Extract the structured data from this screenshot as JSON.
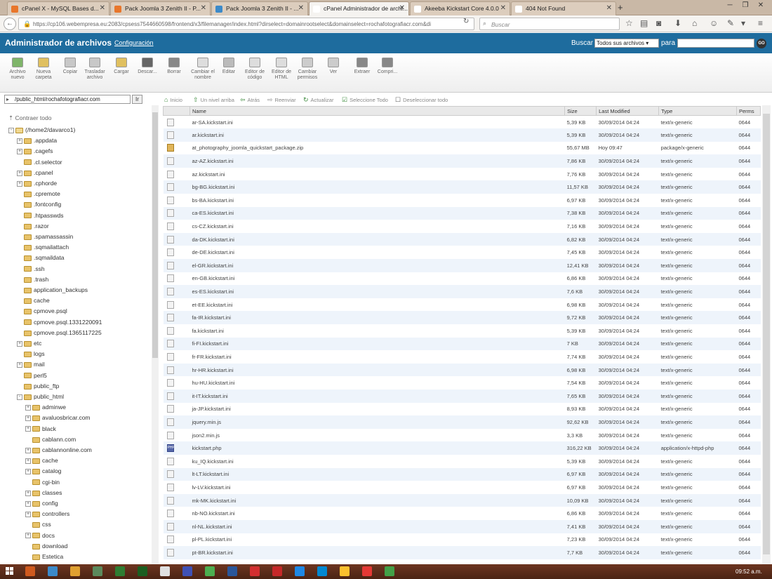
{
  "browser": {
    "tabs": [
      {
        "title": "cPanel X - MySQL Bases d...",
        "color": "#e8762b"
      },
      {
        "title": "Pack Joomla 3 Zenith II - P...",
        "color": "#e8762b"
      },
      {
        "title": "Pack Joomla 3 Zenith II - ...",
        "color": "#3c8ac9"
      },
      {
        "title": "cPanel Administrador de archi...",
        "color": "#ffffff"
      },
      {
        "title": "Akeeba Kickstart Core 4.0.0",
        "color": "#ffffff"
      },
      {
        "title": "404 Not Found",
        "color": "#ffffff"
      }
    ],
    "url": "https://cp106.webempresa.eu:2083/cpsess7544660598/frontend/x3/filemanager/index.html?dirselect=domainrootselect&domainselect=rochafotografiacr.com&di",
    "search_placeholder": "Buscar"
  },
  "cpanel": {
    "title": "Administrador de archivos",
    "config_link": "Configuración",
    "search_label": "Buscar",
    "search_scope": "Todos sus archivos",
    "para_label": "para",
    "go_label": "GO"
  },
  "toolbar": [
    {
      "label": "Archivo nuevo",
      "icon": "new-file-icon",
      "color": "#7fb56a"
    },
    {
      "label": "Nueva carpeta",
      "icon": "new-folder-icon",
      "color": "#e0c060"
    },
    {
      "label": "Copiar",
      "icon": "copy-icon",
      "color": "#c8c8c8"
    },
    {
      "label": "Trasladar archivo",
      "icon": "move-icon",
      "color": "#c8c8c8"
    },
    {
      "label": "Cargar",
      "icon": "upload-icon",
      "color": "#e0c060"
    },
    {
      "label": "Descar...",
      "icon": "download-icon",
      "color": "#666666"
    },
    {
      "label": "Borrar",
      "icon": "delete-icon",
      "color": "#888888"
    },
    {
      "label": "Cambiar el nombre",
      "icon": "rename-icon",
      "color": "#dddddd"
    },
    {
      "label": "Editar",
      "icon": "edit-icon",
      "color": "#bbbbbb"
    },
    {
      "label": "Editor de código",
      "icon": "code-editor-icon",
      "color": "#dddddd"
    },
    {
      "label": "Editor de HTML",
      "icon": "html-editor-icon",
      "color": "#dddddd"
    },
    {
      "label": "Cambiar permisos",
      "icon": "permissions-icon",
      "color": "#cccccc"
    },
    {
      "label": "Ver",
      "icon": "view-icon",
      "color": "#cccccc"
    },
    {
      "label": "Extraer",
      "icon": "extract-icon",
      "color": "#888888"
    },
    {
      "label": "Compri...",
      "icon": "compress-icon",
      "color": "#888888"
    }
  ],
  "pathbar": {
    "path": "/public_html/rochafotografiacr.com",
    "go_label": "Ir",
    "actions": [
      {
        "label": "Inicio",
        "icon": "home-icon"
      },
      {
        "label": "Un nivel arriba",
        "icon": "up-level-icon"
      },
      {
        "label": "Atrás",
        "icon": "back-icon"
      },
      {
        "label": "Reenviar",
        "icon": "forward-icon"
      },
      {
        "label": "Actualizar",
        "icon": "refresh-icon"
      },
      {
        "label": "Seleccione Todo",
        "icon": "select-all-icon"
      },
      {
        "label": "Deseleccionar todo",
        "icon": "deselect-all-icon"
      }
    ]
  },
  "tree": {
    "collapse_all": "Contraer todo",
    "nodes": [
      {
        "label": "(/home2/davarco1)",
        "level": 0,
        "expand": "−",
        "root": true
      },
      {
        "label": ".appdata",
        "level": 1,
        "expand": "+"
      },
      {
        "label": ".cagefs",
        "level": 1,
        "expand": "+"
      },
      {
        "label": ".cl.selector",
        "level": 1,
        "expand": ""
      },
      {
        "label": ".cpanel",
        "level": 1,
        "expand": "+"
      },
      {
        "label": ".cphorde",
        "level": 1,
        "expand": "+"
      },
      {
        "label": ".cpremote",
        "level": 1,
        "expand": ""
      },
      {
        "label": ".fontconfig",
        "level": 1,
        "expand": ""
      },
      {
        "label": ".htpasswds",
        "level": 1,
        "expand": ""
      },
      {
        "label": ".razor",
        "level": 1,
        "expand": ""
      },
      {
        "label": ".spamassassin",
        "level": 1,
        "expand": ""
      },
      {
        "label": ".sqmailattach",
        "level": 1,
        "expand": ""
      },
      {
        "label": ".sqmaildata",
        "level": 1,
        "expand": ""
      },
      {
        "label": ".ssh",
        "level": 1,
        "expand": ""
      },
      {
        "label": ".trash",
        "level": 1,
        "expand": ""
      },
      {
        "label": "application_backups",
        "level": 1,
        "expand": ""
      },
      {
        "label": "cache",
        "level": 1,
        "expand": ""
      },
      {
        "label": "cpmove.psql",
        "level": 1,
        "expand": ""
      },
      {
        "label": "cpmove.psql.1331220091",
        "level": 1,
        "expand": ""
      },
      {
        "label": "cpmove.psql.1365117225",
        "level": 1,
        "expand": ""
      },
      {
        "label": "etc",
        "level": 1,
        "expand": "+"
      },
      {
        "label": "logs",
        "level": 1,
        "expand": ""
      },
      {
        "label": "mail",
        "level": 1,
        "expand": "+"
      },
      {
        "label": "perl5",
        "level": 1,
        "expand": ""
      },
      {
        "label": "public_ftp",
        "level": 1,
        "expand": ""
      },
      {
        "label": "public_html",
        "level": 1,
        "expand": "−"
      },
      {
        "label": "adminwe",
        "level": 2,
        "expand": "+"
      },
      {
        "label": "avaluosbricar.com",
        "level": 2,
        "expand": "+"
      },
      {
        "label": "black",
        "level": 2,
        "expand": "+"
      },
      {
        "label": "cablann.com",
        "level": 2,
        "expand": ""
      },
      {
        "label": "cablannonline.com",
        "level": 2,
        "expand": "+"
      },
      {
        "label": "cache",
        "level": 2,
        "expand": "+"
      },
      {
        "label": "catalog",
        "level": 2,
        "expand": "+"
      },
      {
        "label": "cgi-bin",
        "level": 2,
        "expand": ""
      },
      {
        "label": "classes",
        "level": 2,
        "expand": "+"
      },
      {
        "label": "config",
        "level": 2,
        "expand": "+"
      },
      {
        "label": "controllers",
        "level": 2,
        "expand": "+"
      },
      {
        "label": "css",
        "level": 2,
        "expand": ""
      },
      {
        "label": "docs",
        "level": 2,
        "expand": "+"
      },
      {
        "label": "download",
        "level": 2,
        "expand": ""
      },
      {
        "label": "Estetica",
        "level": 2,
        "expand": ""
      }
    ]
  },
  "table": {
    "headers": [
      "",
      "Name",
      "Size",
      "Last Modified",
      "Type",
      "Perms"
    ],
    "rows": [
      [
        "txt",
        "ar-SA.kickstart.ini",
        "5,39 KB",
        "30/09/2014 04:24",
        "text/x-generic",
        "0644"
      ],
      [
        "txt",
        "ar.kickstart.ini",
        "5,39 KB",
        "30/09/2014 04:24",
        "text/x-generic",
        "0644"
      ],
      [
        "zip",
        "at_photography_joomla_quickstart_package.zip",
        "55,67 MB",
        "Hoy 09:47",
        "package/x-generic",
        "0644"
      ],
      [
        "txt",
        "az-AZ.kickstart.ini",
        "7,86 KB",
        "30/09/2014 04:24",
        "text/x-generic",
        "0644"
      ],
      [
        "txt",
        "az.kickstart.ini",
        "7,76 KB",
        "30/09/2014 04:24",
        "text/x-generic",
        "0644"
      ],
      [
        "txt",
        "bg-BG.kickstart.ini",
        "11,57 KB",
        "30/09/2014 04:24",
        "text/x-generic",
        "0644"
      ],
      [
        "txt",
        "bs-BA.kickstart.ini",
        "6,97 KB",
        "30/09/2014 04:24",
        "text/x-generic",
        "0644"
      ],
      [
        "txt",
        "ca-ES.kickstart.ini",
        "7,38 KB",
        "30/09/2014 04:24",
        "text/x-generic",
        "0644"
      ],
      [
        "txt",
        "cs-CZ.kickstart.ini",
        "7,16 KB",
        "30/09/2014 04:24",
        "text/x-generic",
        "0644"
      ],
      [
        "txt",
        "da-DK.kickstart.ini",
        "6,82 KB",
        "30/09/2014 04:24",
        "text/x-generic",
        "0644"
      ],
      [
        "txt",
        "de-DE.kickstart.ini",
        "7,45 KB",
        "30/09/2014 04:24",
        "text/x-generic",
        "0644"
      ],
      [
        "txt",
        "el-GR.kickstart.ini",
        "12,41 KB",
        "30/09/2014 04:24",
        "text/x-generic",
        "0644"
      ],
      [
        "txt",
        "en-GB.kickstart.ini",
        "6,86 KB",
        "30/09/2014 04:24",
        "text/x-generic",
        "0644"
      ],
      [
        "txt",
        "es-ES.kickstart.ini",
        "7,6 KB",
        "30/09/2014 04:24",
        "text/x-generic",
        "0644"
      ],
      [
        "txt",
        "et-EE.kickstart.ini",
        "6,98 KB",
        "30/09/2014 04:24",
        "text/x-generic",
        "0644"
      ],
      [
        "txt",
        "fa-IR.kickstart.ini",
        "9,72 KB",
        "30/09/2014 04:24",
        "text/x-generic",
        "0644"
      ],
      [
        "txt",
        "fa.kickstart.ini",
        "5,39 KB",
        "30/09/2014 04:24",
        "text/x-generic",
        "0644"
      ],
      [
        "txt",
        "fi-FI.kickstart.ini",
        "7 KB",
        "30/09/2014 04:24",
        "text/x-generic",
        "0644"
      ],
      [
        "txt",
        "fr-FR.kickstart.ini",
        "7,74 KB",
        "30/09/2014 04:24",
        "text/x-generic",
        "0644"
      ],
      [
        "txt",
        "hr-HR.kickstart.ini",
        "6,98 KB",
        "30/09/2014 04:24",
        "text/x-generic",
        "0644"
      ],
      [
        "txt",
        "hu-HU.kickstart.ini",
        "7,54 KB",
        "30/09/2014 04:24",
        "text/x-generic",
        "0644"
      ],
      [
        "txt",
        "it-IT.kickstart.ini",
        "7,65 KB",
        "30/09/2014 04:24",
        "text/x-generic",
        "0644"
      ],
      [
        "txt",
        "ja-JP.kickstart.ini",
        "8,93 KB",
        "30/09/2014 04:24",
        "text/x-generic",
        "0644"
      ],
      [
        "txt",
        "jquery.min.js",
        "92,62 KB",
        "30/09/2014 04:24",
        "text/x-generic",
        "0644"
      ],
      [
        "txt",
        "json2.min.js",
        "3,3 KB",
        "30/09/2014 04:24",
        "text/x-generic",
        "0644"
      ],
      [
        "php",
        "kickstart.php",
        "316,22 KB",
        "30/09/2014 04:24",
        "application/x-httpd-php",
        "0644"
      ],
      [
        "txt",
        "ku_IQ.kickstart.ini",
        "5,39 KB",
        "30/09/2014 04:24",
        "text/x-generic",
        "0644"
      ],
      [
        "txt",
        "lt-LT.kickstart.ini",
        "6,97 KB",
        "30/09/2014 04:24",
        "text/x-generic",
        "0644"
      ],
      [
        "txt",
        "lv-LV.kickstart.ini",
        "6,97 KB",
        "30/09/2014 04:24",
        "text/x-generic",
        "0644"
      ],
      [
        "txt",
        "mk-MK.kickstart.ini",
        "10,09 KB",
        "30/09/2014 04:24",
        "text/x-generic",
        "0644"
      ],
      [
        "txt",
        "nb-NO.kickstart.ini",
        "6,86 KB",
        "30/09/2014 04:24",
        "text/x-generic",
        "0644"
      ],
      [
        "txt",
        "nl-NL.kickstart.ini",
        "7,41 KB",
        "30/09/2014 04:24",
        "text/x-generic",
        "0644"
      ],
      [
        "txt",
        "pl-PL.kickstart.ini",
        "7,23 KB",
        "30/09/2014 04:24",
        "text/x-generic",
        "0644"
      ],
      [
        "txt",
        "pt-BR.kickstart.ini",
        "7,7 KB",
        "30/09/2014 04:24",
        "text/x-generic",
        "0644"
      ]
    ]
  },
  "taskbar": {
    "clock": "09:52 a.m.",
    "apps": [
      "#d05a1e",
      "#3c8ac9",
      "#e0a030",
      "#5c8a5c",
      "#2e7d32",
      "#1b5e20",
      "#e0e0e0",
      "#3f51b5",
      "#4caf50",
      "#2b579a",
      "#d32f2f",
      "#c62828",
      "#1e88e5",
      "#0288d1",
      "#fbc02d",
      "#e53935",
      "#43a047"
    ]
  }
}
